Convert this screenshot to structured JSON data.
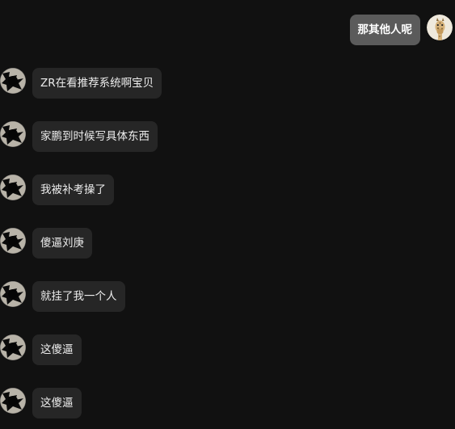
{
  "messages": [
    {
      "direction": "outgoing",
      "avatar": "giraffe-avatar",
      "text": "那其他人呢"
    },
    {
      "direction": "incoming",
      "avatar": "dark-figure-avatar",
      "text": "ZR在看推荐系统啊宝贝"
    },
    {
      "direction": "incoming",
      "avatar": "dark-figure-avatar",
      "text": "家鹏到时候写具体东西"
    },
    {
      "direction": "incoming",
      "avatar": "dark-figure-avatar",
      "text": "我被补考操了"
    },
    {
      "direction": "incoming",
      "avatar": "dark-figure-avatar",
      "text": "傻逼刘庚"
    },
    {
      "direction": "incoming",
      "avatar": "dark-figure-avatar",
      "text": "就挂了我一个人"
    },
    {
      "direction": "incoming",
      "avatar": "dark-figure-avatar",
      "text": "这傻逼"
    },
    {
      "direction": "incoming",
      "avatar": "dark-figure-avatar",
      "text": "这傻逼"
    }
  ],
  "colors": {
    "background": "#111111",
    "incoming_bubble": "#262626",
    "outgoing_bubble": "#5b5b5b",
    "text": "#ececec"
  }
}
